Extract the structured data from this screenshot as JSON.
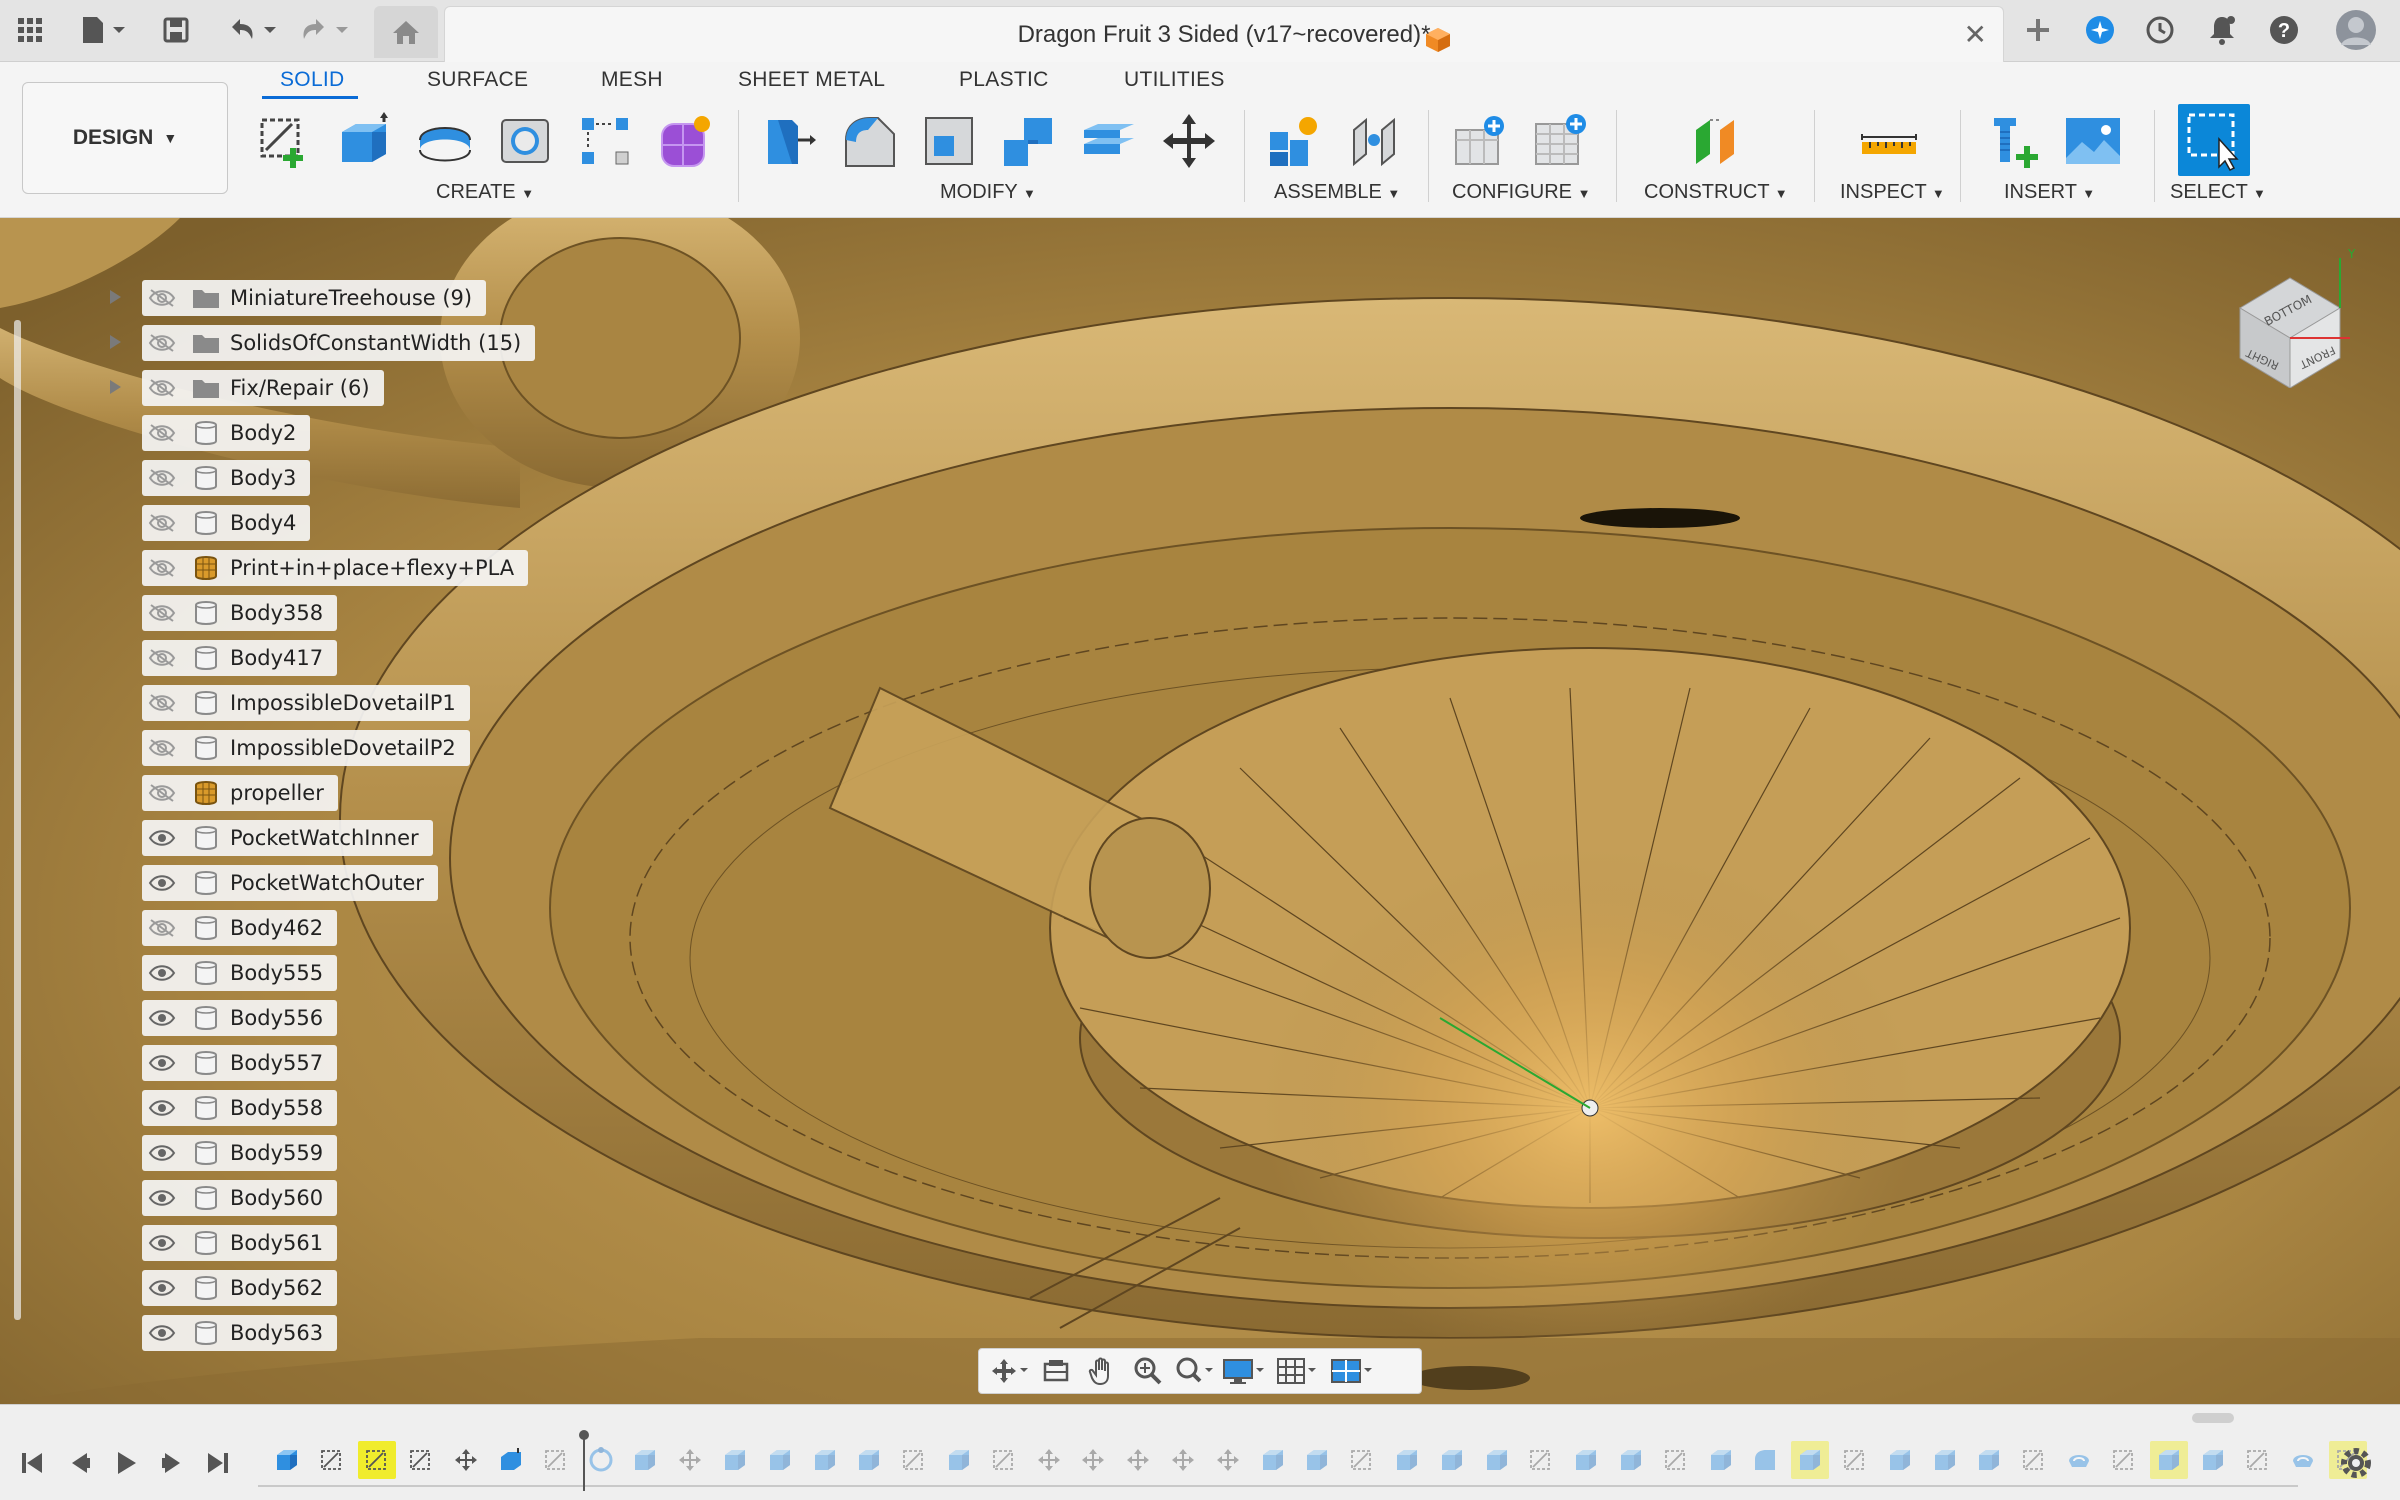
{
  "window": {
    "document_title": "Dragon Fruit 3 Sided (v17~recovered)*"
  },
  "toolbar": {
    "workspace_label": "DESIGN",
    "tabs": [
      {
        "label": "SOLID",
        "active": true
      },
      {
        "label": "SURFACE",
        "active": false
      },
      {
        "label": "MESH",
        "active": false
      },
      {
        "label": "SHEET METAL",
        "active": false
      },
      {
        "label": "PLASTIC",
        "active": false
      },
      {
        "label": "UTILITIES",
        "active": false
      }
    ],
    "groups": {
      "create": "CREATE",
      "modify": "MODIFY",
      "assemble": "ASSEMBLE",
      "configure": "CONFIGURE",
      "construct": "CONSTRUCT",
      "inspect": "INSPECT",
      "insert": "INSERT",
      "select": "SELECT"
    },
    "colors": {
      "accent": "#0a6bd6",
      "solid_blue": "#2f8fe0",
      "select_blue": "#0b87d8"
    }
  },
  "browser": {
    "nodes": [
      {
        "label": "MiniatureTreehouse (9)",
        "type": "folder",
        "visible": false
      },
      {
        "label": "SolidsOfConstantWidth (15)",
        "type": "folder",
        "visible": false
      },
      {
        "label": "Fix/Repair (6)",
        "type": "folder",
        "visible": false
      },
      {
        "label": "Body2",
        "type": "body",
        "visible": false
      },
      {
        "label": "Body3",
        "type": "body",
        "visible": false
      },
      {
        "label": "Body4",
        "type": "body",
        "visible": false
      },
      {
        "label": "Print+in+place+flexy+PLA",
        "type": "mesh",
        "visible": false
      },
      {
        "label": "Body358",
        "type": "body",
        "visible": false
      },
      {
        "label": "Body417",
        "type": "body",
        "visible": false
      },
      {
        "label": "ImpossibleDovetailP1",
        "type": "body",
        "visible": false
      },
      {
        "label": "ImpossibleDovetailP2",
        "type": "body",
        "visible": false
      },
      {
        "label": "propeller",
        "type": "mesh",
        "visible": false
      },
      {
        "label": "PocketWatchInner",
        "type": "body",
        "visible": true
      },
      {
        "label": "PocketWatchOuter",
        "type": "body",
        "visible": true
      },
      {
        "label": "Body462",
        "type": "body",
        "visible": false
      },
      {
        "label": "Body555",
        "type": "body",
        "visible": true
      },
      {
        "label": "Body556",
        "type": "body",
        "visible": true
      },
      {
        "label": "Body557",
        "type": "body",
        "visible": true
      },
      {
        "label": "Body558",
        "type": "body",
        "visible": true
      },
      {
        "label": "Body559",
        "type": "body",
        "visible": true
      },
      {
        "label": "Body560",
        "type": "body",
        "visible": true
      },
      {
        "label": "Body561",
        "type": "body",
        "visible": true
      },
      {
        "label": "Body562",
        "type": "body",
        "visible": true
      },
      {
        "label": "Body563",
        "type": "body",
        "visible": true
      }
    ]
  },
  "viewcube": {
    "faces": [
      "BOTTOM",
      "RIGHT",
      "FRONT"
    ],
    "axis_y": "Y"
  },
  "navbar": {
    "items": [
      "orbit-icon",
      "look-at-icon",
      "pan-icon",
      "zoom-icon",
      "fit-icon",
      "display-settings-icon",
      "grid-settings-icon",
      "viewports-icon"
    ]
  },
  "timeline": {
    "features": [
      "box",
      "sketch",
      "sketch",
      "sketch",
      "move",
      "extrude",
      "sketch",
      "pattern",
      "box",
      "move",
      "box",
      "box",
      "box",
      "box",
      "sketch",
      "box",
      "sketch",
      "move",
      "move",
      "move",
      "move",
      "move",
      "box",
      "box",
      "sketch",
      "box",
      "box",
      "box",
      "sketch",
      "box",
      "box",
      "sketch",
      "box",
      "fillet",
      "box",
      "sketch",
      "box",
      "box",
      "box",
      "sketch",
      "shell",
      "sketch",
      "box",
      "box",
      "sketch",
      "shell",
      "sketch"
    ],
    "highlighted": [
      2,
      34,
      42,
      46
    ],
    "highlight_color": "#f0ec2c"
  }
}
